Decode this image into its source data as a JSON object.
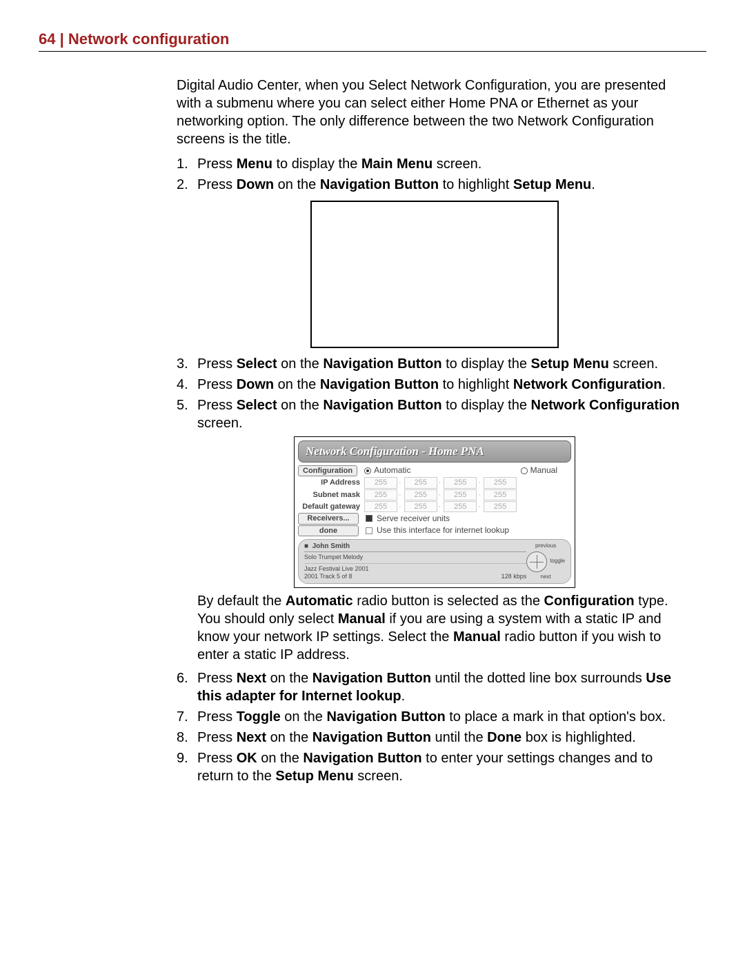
{
  "header": {
    "page_num": "64",
    "sep": " | ",
    "title": "Network configuration"
  },
  "intro": "Digital Audio Center, when you Select Network Configuration, you are presented with a submenu where you can select either Home PNA or Ethernet as your networking option. The only difference between the two Network Configuration screens is the title.",
  "steps": {
    "s1": {
      "n": "1.",
      "a": "Press ",
      "b": "Menu",
      "c": " to display the ",
      "d": "Main Menu",
      "e": " screen."
    },
    "s2": {
      "n": "2.",
      "a": "Press ",
      "b": "Down",
      "c": " on the ",
      "d": "Navigation Button",
      "e": " to highlight ",
      "f": "Setup Menu",
      "g": "."
    },
    "s3": {
      "n": "3.",
      "a": "Press ",
      "b": "Select",
      "c": " on the ",
      "d": "Navigation Button",
      "e": " to display the ",
      "f": "Setup Menu",
      "g": " screen."
    },
    "s4": {
      "n": "4.",
      "a": "Press ",
      "b": "Down",
      "c": " on the ",
      "d": "Navigation Button",
      "e": " to highlight ",
      "f": "Network Configuration",
      "g": "."
    },
    "s5": {
      "n": "5.",
      "a": "Press ",
      "b": "Select",
      "c": " on the ",
      "d": "Navigation Button",
      "e": " to display the ",
      "f": "Network Configuration",
      "g": " screen."
    },
    "para": {
      "a": "By default the ",
      "b": "Automatic",
      "c": " radio button is selected as the ",
      "d": "Configuration",
      "e": " type. You should only select ",
      "f": "Manual",
      "g": " if you are using a system with a static IP and know your network IP settings. Select the ",
      "h": "Manual",
      "i": " radio button if you wish to enter a static IP address."
    },
    "s6": {
      "n": "6.",
      "a": "Press ",
      "b": "Next",
      "c": " on the ",
      "d": "Navigation Button",
      "e": " until the dotted line box surrounds ",
      "f": "Use this adapter for Internet lookup",
      "g": "."
    },
    "s7": {
      "n": "7.",
      "a": "Press ",
      "b": "Toggle",
      "c": " on the ",
      "d": "Navigation Button",
      "e": " to place a mark in that option's box."
    },
    "s8": {
      "n": "8.",
      "a": "Press ",
      "b": "Next",
      "c": " on the ",
      "d": "Navigation Button",
      "e": " until the ",
      "f": "Done",
      "g": " box is highlighted."
    },
    "s9": {
      "n": "9.",
      "a": "Press ",
      "b": "OK",
      "c": " on the ",
      "d": "Navigation Button",
      "e": " to enter your settings changes and to return to the ",
      "f": "Setup Menu",
      "g": " screen."
    }
  },
  "shot": {
    "title": "Network Configuration - Home PNA",
    "config_label": "Configuration",
    "auto": "Automatic",
    "manual": "Manual",
    "ip_label": "IP Address",
    "subnet_label": "Subnet mask",
    "gw_label": "Default gateway",
    "oct": "255",
    "receivers": "Receivers...",
    "serve": "Serve receiver units",
    "done": "done",
    "lookup": "Use this interface for internet lookup",
    "player_name": "John Smith",
    "track_title": "Solo Trumpet Melody",
    "album": "Jazz Festival Live 2001",
    "track_info": "2001  Track 5 of 8",
    "kbps": "128 kbps",
    "prev": "previous",
    "toggle": "toggle",
    "next": "next"
  }
}
